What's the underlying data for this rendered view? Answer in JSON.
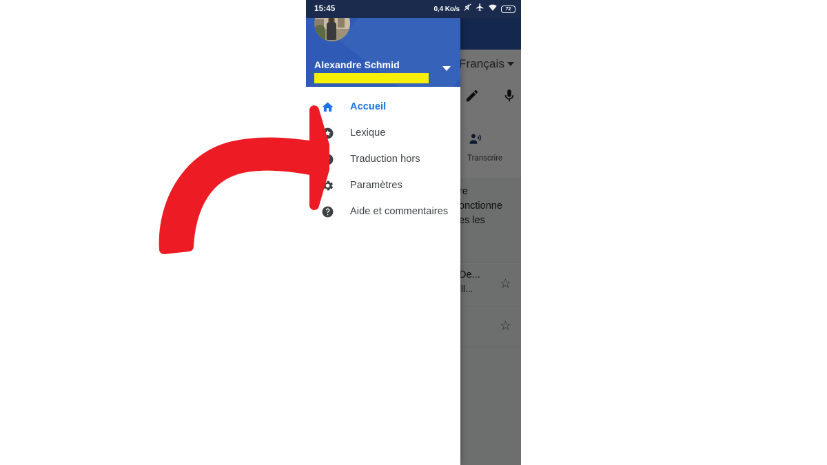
{
  "status_bar": {
    "clock": "15:45",
    "data_rate": "0,4 Ko/s",
    "battery_level": "72",
    "icons": [
      "mute-icon",
      "airplane-icon",
      "wifi-icon",
      "battery-icon"
    ]
  },
  "drawer": {
    "account": {
      "name": "Alexandre Schmid",
      "email_redacted": "",
      "avatar_name": "user-avatar",
      "expand_icon": "chevron-down-icon"
    },
    "items": [
      {
        "label": "Accueil",
        "icon": "home-icon",
        "active": true
      },
      {
        "label": "Lexique",
        "icon": "star-circle-icon",
        "active": false
      },
      {
        "label": "Traduction hors",
        "icon": "check-circle-icon",
        "active": false
      },
      {
        "label": "Paramètres",
        "icon": "gear-icon",
        "active": false
      },
      {
        "label": "Aide et commentaires",
        "icon": "help-circle-icon",
        "active": false
      }
    ]
  },
  "background_app": {
    "language_selector": "Français",
    "language_caret_icon": "chevron-down-icon",
    "tools": [
      {
        "icon": "handwriting-pen-icon"
      },
      {
        "icon": "microphone-icon"
      }
    ],
    "transcribe": {
      "label": "Transcrire",
      "icon": "person-speaking-icon"
    },
    "cards": [
      {
        "lines": [
          "re",
          "onctionne",
          "es les"
        ],
        "star_icon": null
      },
      {
        "lines": [
          "De...",
          "ill..."
        ],
        "star_icon": "star-outline-icon"
      },
      {
        "lines": [],
        "star_icon": "star-outline-icon"
      }
    ]
  },
  "annotation": {
    "arrow": {
      "name": "red-curved-arrow",
      "color": "#ED1C24",
      "points_to": "Traduction hors"
    }
  },
  "colors": {
    "drawer_header_blue": "#2F5BB7",
    "status_bar_navy": "#1B2B4D",
    "active_item_blue": "#1A73E8",
    "redaction_yellow": "#F7EF00",
    "arrow_red": "#ED1C24"
  }
}
